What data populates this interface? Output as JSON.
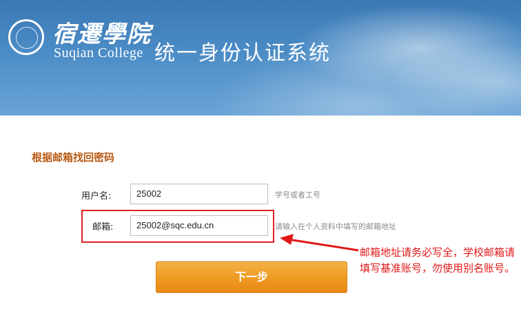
{
  "header": {
    "college_cn": "宿遷學院",
    "college_en": "Suqian College",
    "system_title": "统一身份认证系统"
  },
  "form": {
    "section_title": "根据邮箱找回密码",
    "username": {
      "label": "用户名:",
      "value": "25002",
      "hint": "学号或者工号"
    },
    "email": {
      "label": "邮箱:",
      "value": "25002@sqc.edu.cn",
      "hint": "请输入在个人资料中填写的邮箱地址"
    },
    "next_button": "下一步"
  },
  "annotation": {
    "text": "邮箱地址请务必写全，学校邮箱请填写基准账号，勿使用别名账号。",
    "color": "#e01818"
  },
  "colors": {
    "section_title": "#b85a14",
    "button": "#ee9a22",
    "banner": "#4b8cc6"
  }
}
